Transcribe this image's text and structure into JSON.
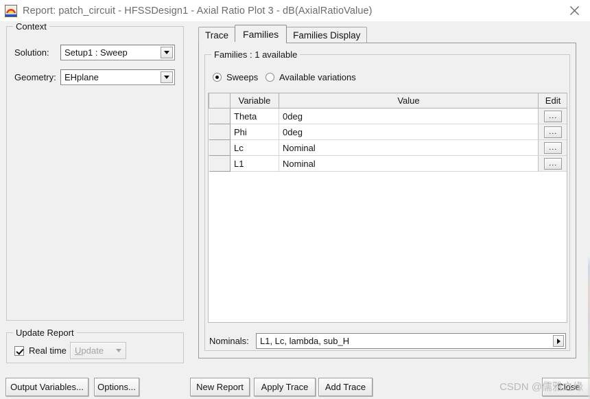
{
  "window": {
    "title": "Report: patch_circuit - HFSSDesign1 - Axial Ratio Plot 3 - dB(AxialRatioValue)",
    "icon": "hfss-app-icon",
    "close_label": "✕"
  },
  "context": {
    "group_title": "Context",
    "solution_label": "Solution:",
    "solution_value": "Setup1 : Sweep",
    "geometry_label": "Geometry:",
    "geometry_value": "EHplane"
  },
  "update_report": {
    "group_title": "Update Report",
    "realtime_label": "Real time",
    "realtime_checked": true,
    "update_label": "Update",
    "update_disabled": true
  },
  "tabs": [
    {
      "label": "Trace",
      "active": false
    },
    {
      "label": "Families",
      "active": true
    },
    {
      "label": "Families Display",
      "active": false
    }
  ],
  "families": {
    "group_title": "Families : 1 available",
    "radio_sweeps": "Sweeps",
    "radio_available_variations": "Available variations",
    "selected_radio": "Sweeps",
    "columns": [
      "",
      "Variable",
      "Value",
      "Edit"
    ],
    "rows": [
      {
        "variable": "Theta",
        "value": "0deg",
        "edit": "..."
      },
      {
        "variable": "Phi",
        "value": "0deg",
        "edit": "..."
      },
      {
        "variable": "Lc",
        "value": "Nominal",
        "edit": "..."
      },
      {
        "variable": "L1",
        "value": "Nominal",
        "edit": "..."
      }
    ],
    "nominals_label": "Nominals:",
    "nominals_value": "L1, Lc, lambda, sub_H"
  },
  "footer": {
    "output_variables": "Output Variables...",
    "options": "Options...",
    "new_report": "New Report",
    "apply_trace": "Apply Trace",
    "add_trace": "Add Trace",
    "close": "Close"
  },
  "watermark": "CSDN @儒雅之缘"
}
